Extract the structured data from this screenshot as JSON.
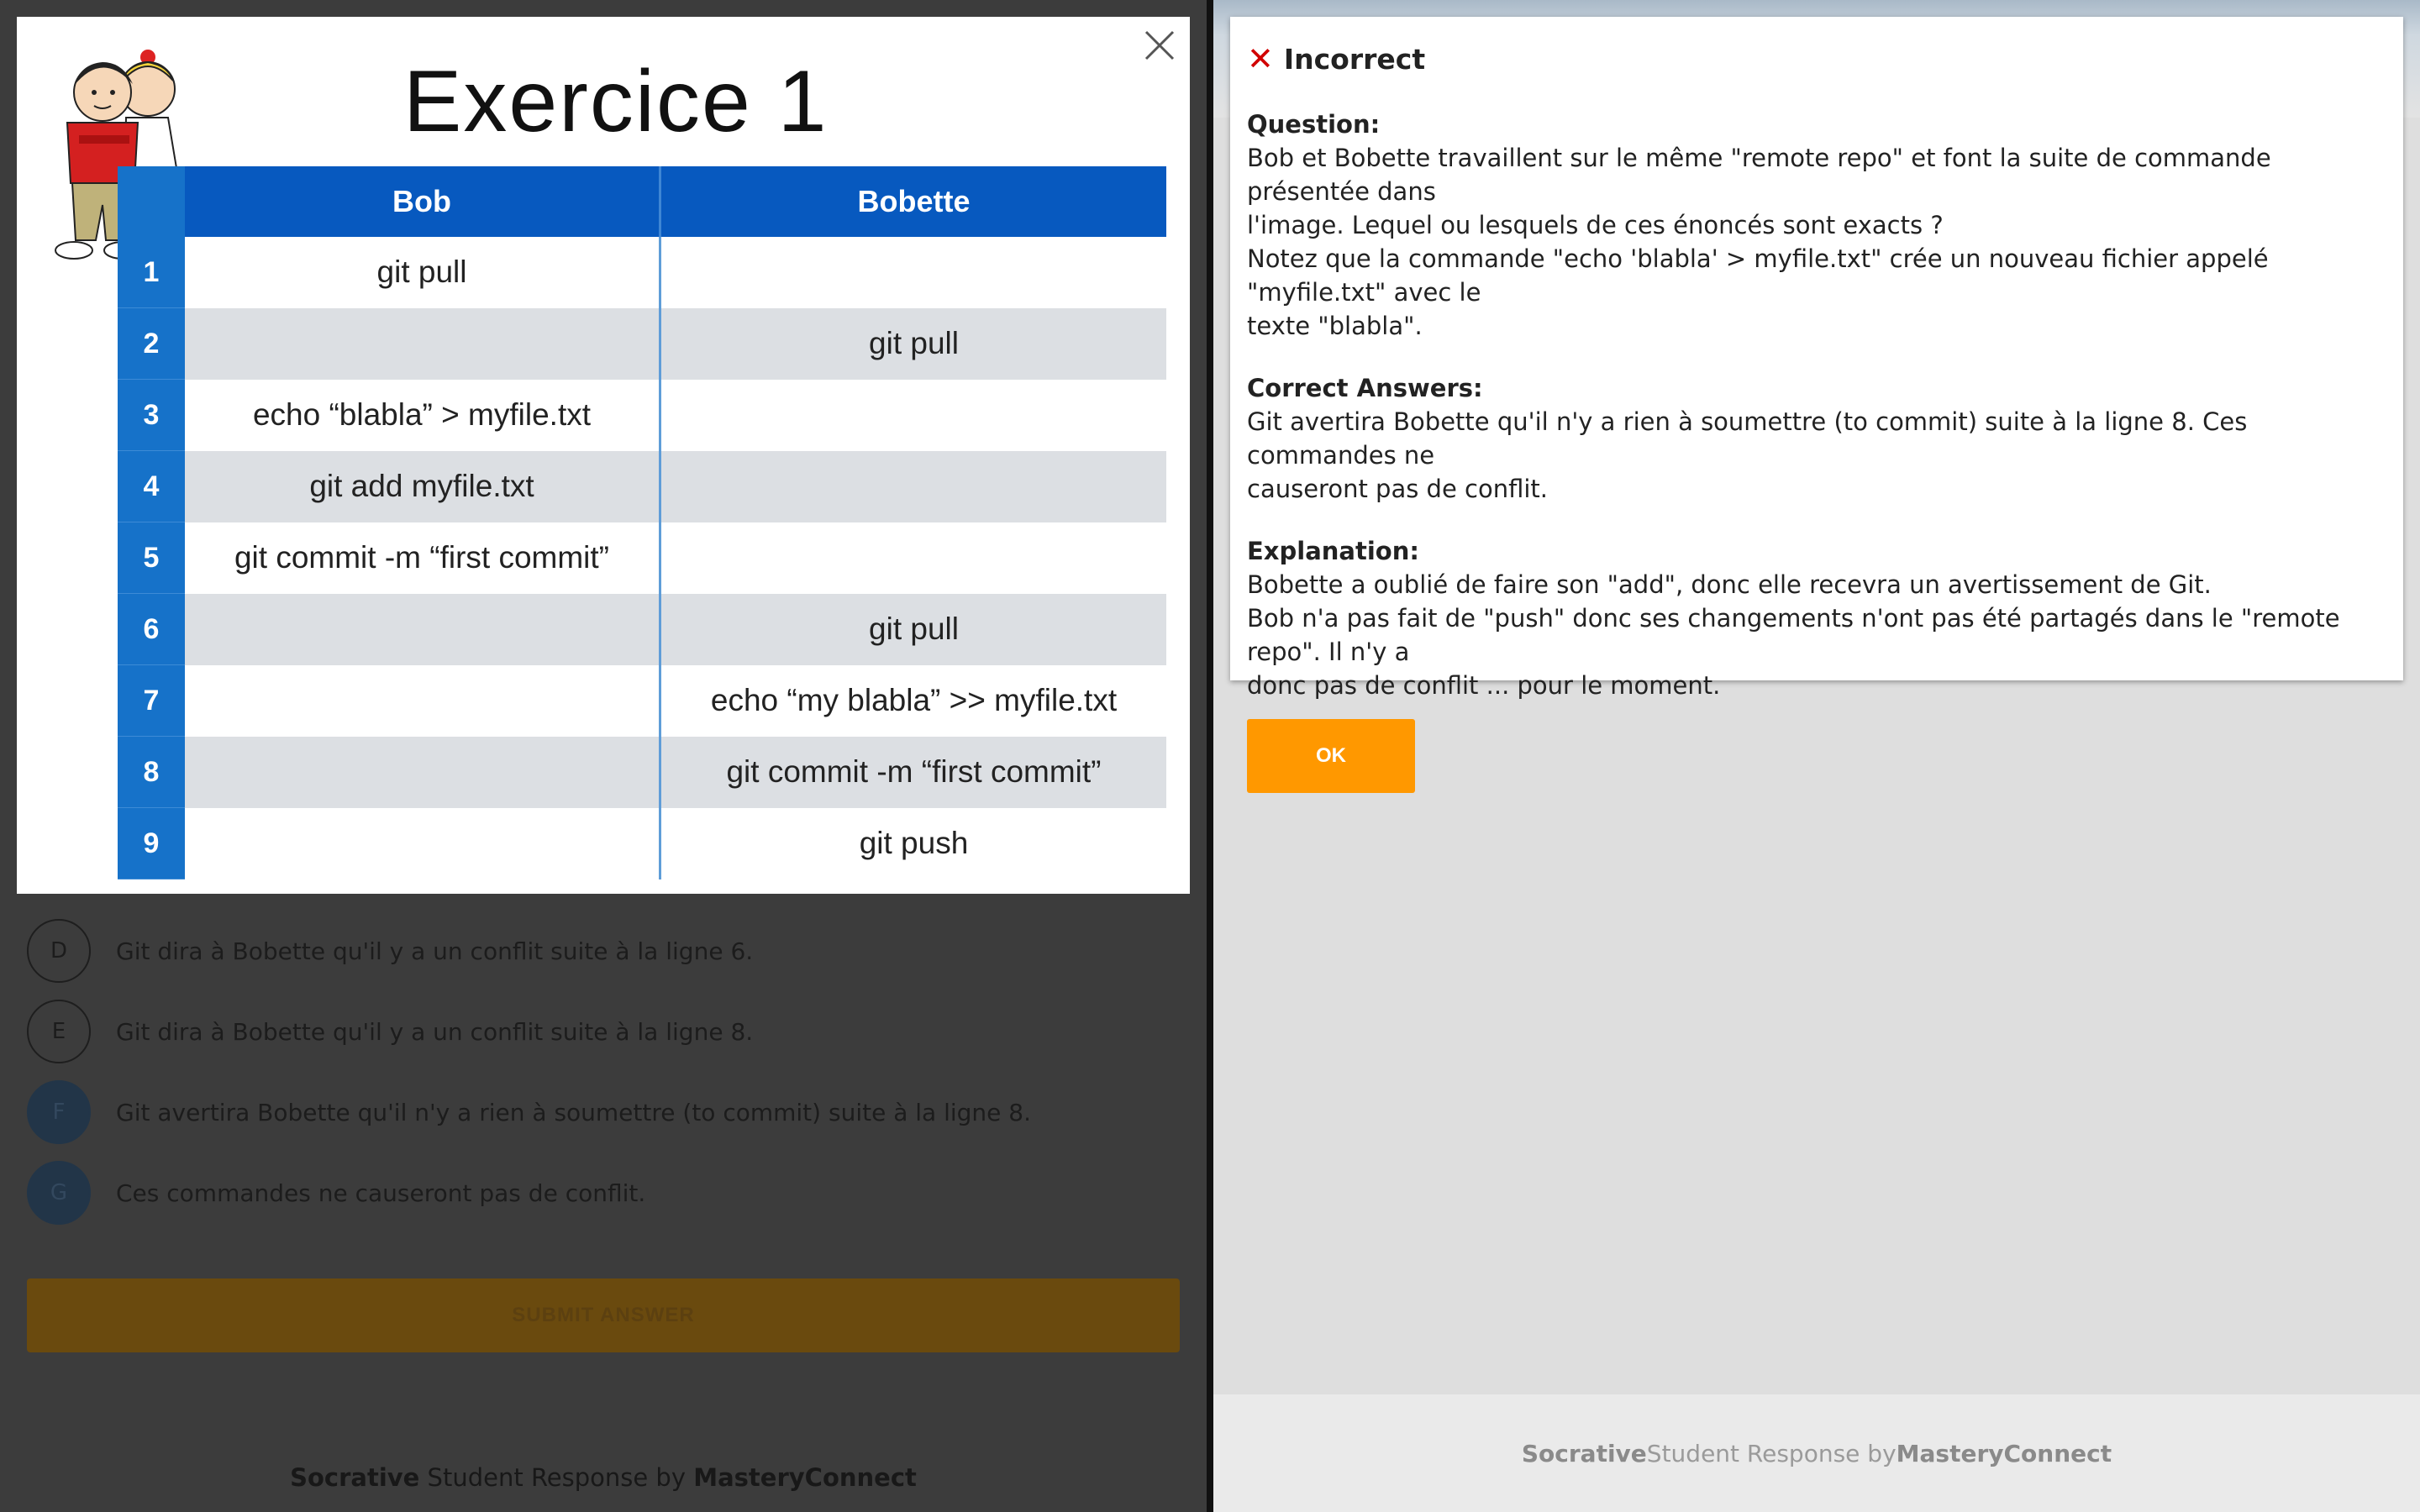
{
  "left": {
    "choices": [
      {
        "letter": "D",
        "text": "Git dira à Bobette qu'il y a un conflit suite à la ligne 6.",
        "selected": false
      },
      {
        "letter": "E",
        "text": "Git dira à Bobette qu'il y a un conflit suite à la ligne 8.",
        "selected": false
      },
      {
        "letter": "F",
        "text": "Git avertira Bobette qu'il n'y a rien à soumettre (to commit) suite à la ligne 8.",
        "selected": true
      },
      {
        "letter": "G",
        "text": "Ces commandes ne causeront pas de conflit.",
        "selected": true
      }
    ],
    "submit_label": "SUBMIT ANSWER",
    "footer": {
      "brand": "Socrative",
      "middle": " Student Response by ",
      "company": "MasteryConnect"
    }
  },
  "image_modal": {
    "close_icon": "close-icon",
    "title": "Exercice 1",
    "table": {
      "headers": [
        "",
        "Bob",
        "Bobette"
      ],
      "rows": [
        {
          "num": "1",
          "bob": "git pull",
          "bobette": ""
        },
        {
          "num": "2",
          "bob": "",
          "bobette": "git pull"
        },
        {
          "num": "3",
          "bob": "echo “blabla” > myfile.txt",
          "bobette": ""
        },
        {
          "num": "4",
          "bob": "git add myfile.txt",
          "bobette": ""
        },
        {
          "num": "5",
          "bob": "git commit -m “first commit”",
          "bobette": ""
        },
        {
          "num": "6",
          "bob": "",
          "bobette": "git pull"
        },
        {
          "num": "7",
          "bob": "",
          "bobette": "echo “my blabla” >> myfile.txt"
        },
        {
          "num": "8",
          "bob": "",
          "bobette": "git commit -m “first commit”"
        },
        {
          "num": "9",
          "bob": "",
          "bobette": "git push"
        }
      ]
    }
  },
  "result": {
    "icon": "x-icon",
    "title": "Incorrect",
    "question_label": "Question:",
    "question_lines": [
      "Bob et Bobette travaillent sur le même \"remote repo\" et font la suite de commande présentée dans",
      "l'image. Lequel ou lesquels de ces énoncés sont exacts ?",
      "Notez que la commande \"echo 'blabla' > myfile.txt\" crée un nouveau fichier appelé \"myfile.txt\" avec le",
      "texte \"blabla\"."
    ],
    "answers_label": "Correct Answers:",
    "answers_lines": [
      "Git avertira Bobette qu'il n'y a rien à soumettre (to commit) suite à la ligne 8. Ces commandes ne",
      "causeront pas de conflit."
    ],
    "explanation_label": "Explanation:",
    "explanation_lines": [
      "Bobette a oublié de faire son \"add\", donc elle recevra un avertissement de Git.",
      "Bob n'a pas fait de \"push\" donc ses changements n'ont pas été partagés dans le \"remote repo\". Il n'y a",
      "donc pas de conflit ... pour le moment."
    ],
    "ok_label": "OK"
  },
  "right_footer": {
    "brand": "Socrative",
    "middle": " Student Response by ",
    "company": "MasteryConnect"
  },
  "colors": {
    "accent": "#ff9800",
    "incorrect": "#d10000",
    "table_header": "#0759bf"
  }
}
